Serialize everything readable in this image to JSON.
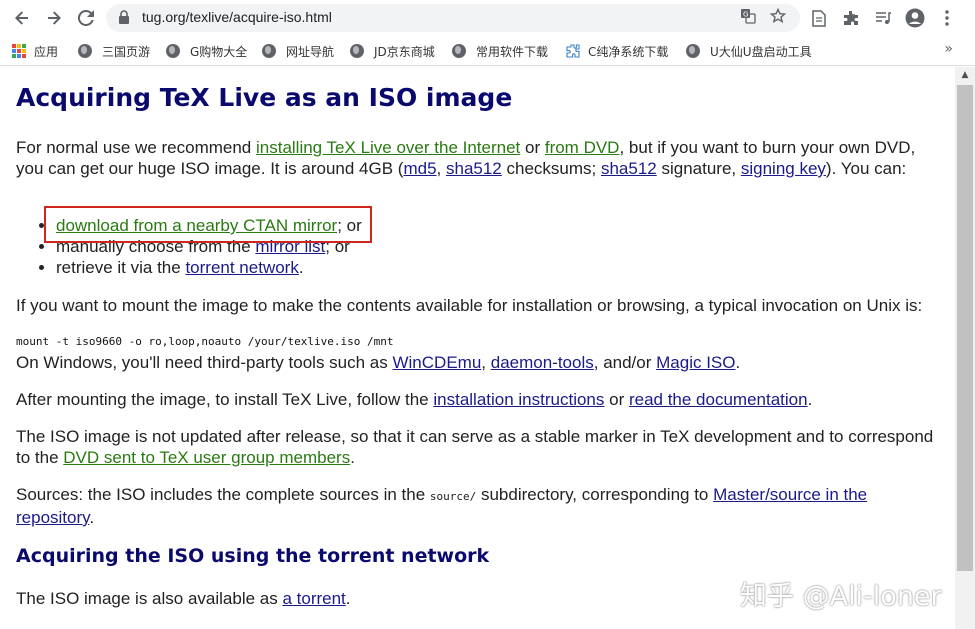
{
  "browser": {
    "url": "tug.org/texlive/acquire-iso.html",
    "icons": [
      "back-icon",
      "forward-icon",
      "reload-icon",
      "lock-icon",
      "translate-icon",
      "star-icon",
      "reading-list-icon",
      "extensions-icon",
      "media-icon",
      "profile-icon",
      "menu-icon"
    ]
  },
  "bookmarks": {
    "apps_label": "应用",
    "items": [
      {
        "label": "三国页游"
      },
      {
        "label": "G购物大全"
      },
      {
        "label": "网址导航"
      },
      {
        "label": "JD京东商城"
      },
      {
        "label": "常用软件下载"
      },
      {
        "label": "C纯净系统下载"
      },
      {
        "label": "U大仙U盘启动工具"
      }
    ],
    "more": "»"
  },
  "page": {
    "title": "Acquiring TeX Live as an ISO image",
    "intro": {
      "t1": "For normal use we recommend ",
      "link1": "installing TeX Live over the Internet",
      "t2": " or ",
      "link2": "from DVD",
      "t3": ", but if you want to burn your own DVD, you can get our huge ISO image. It is around 4GB (",
      "link3": "md5",
      "t4": ", ",
      "link4": "sha512",
      "t5": " checksums; ",
      "link5": "sha512",
      "t6": " signature, ",
      "link6": "signing key",
      "t7": "). You can:"
    },
    "options": {
      "o1_link": "download from a nearby CTAN mirror",
      "o1_tail": "; or",
      "o2_pre": "manually choose from the ",
      "o2_link": "mirror list",
      "o2_tail": "; or",
      "o3_pre": "retrieve it via the ",
      "o3_link": "torrent network",
      "o3_tail": "."
    },
    "mount_text": "If you want to mount the image to make the contents available for installation or browsing, a typical invocation on Unix is:",
    "mount_cmd": "mount -t iso9660 -o ro,loop,noauto /your/texlive.iso /mnt",
    "windows": {
      "t1": "On Windows, you'll need third-party tools such as ",
      "link1": "WinCDEmu",
      "t2": ", ",
      "link2": "daemon-tools",
      "t3": ", and/or ",
      "link3": "Magic ISO",
      "t4": "."
    },
    "after": {
      "t1": "After mounting the image, to install TeX Live, follow the ",
      "link1": "installation instructions",
      "t2": " or ",
      "link2": "read the documentation",
      "t3": "."
    },
    "update": {
      "t1": "The ISO image is not updated after release, so that it can serve as a stable marker in TeX development and to correspond to the ",
      "link1": "DVD sent to TeX user group members",
      "t2": "."
    },
    "sources": {
      "t1": "Sources: the ISO includes the complete sources in the ",
      "code": "source/",
      "t2": " subdirectory, corresponding to ",
      "link1": "Master/source in the repository",
      "t3": "."
    },
    "torrent_heading": "Acquiring the ISO using the torrent network",
    "torrent": {
      "t1": "The ISO image is also available as ",
      "link1": "a torrent",
      "t2": "."
    }
  },
  "watermark": "知乎 @Ali-loner",
  "colors": {
    "heading": "#0a0a6e",
    "link_visited_green": "#2a7a12",
    "link_blue": "#1b1a8a",
    "annotation_box": "#d0271d"
  }
}
